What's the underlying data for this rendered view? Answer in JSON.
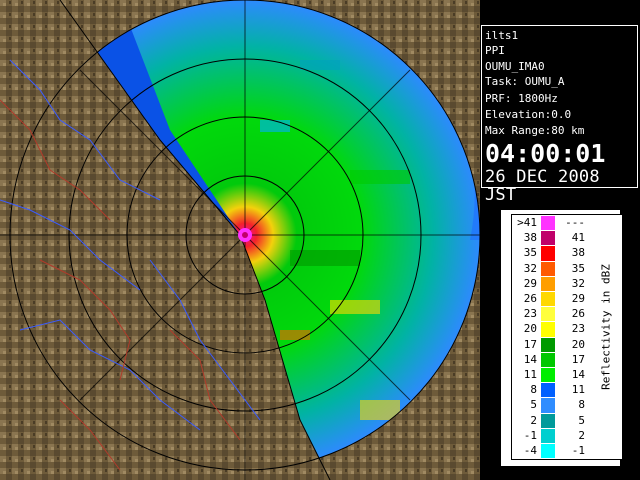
{
  "info": {
    "station": "ilts1",
    "mode": "PPI",
    "product": "OUMU_IMA0",
    "task": "Task: OUMU_A",
    "prf": "PRF: 1800Hz",
    "elevation": "Elevation:0.0",
    "max_range": "Max Range:80 km",
    "time": "04:00:01",
    "date": "26 DEC 2008 JST"
  },
  "legend": {
    "title": "Reflectivity in dBZ",
    "rows": [
      {
        "low": ">41",
        "high": "---",
        "color": "#ff33ff"
      },
      {
        "low": "38",
        "high": "41",
        "color": "#c0006a"
      },
      {
        "low": "35",
        "high": "38",
        "color": "#ff0000"
      },
      {
        "low": "32",
        "high": "35",
        "color": "#ff5a00"
      },
      {
        "low": "29",
        "high": "32",
        "color": "#ff9e00"
      },
      {
        "low": "26",
        "high": "29",
        "color": "#ffd800"
      },
      {
        "low": "23",
        "high": "26",
        "color": "#ffff3c"
      },
      {
        "low": "20",
        "high": "23",
        "color": "#ffff00"
      },
      {
        "low": "17",
        "high": "20",
        "color": "#009a00"
      },
      {
        "low": "14",
        "high": "17",
        "color": "#00c800"
      },
      {
        "low": "11",
        "high": "14",
        "color": "#00ee00"
      },
      {
        "low": "8",
        "high": "11",
        "color": "#0060ff"
      },
      {
        "low": "5",
        "high": "8",
        "color": "#2f8dff"
      },
      {
        "low": "2",
        "high": "5",
        "color": "#009a9a"
      },
      {
        "low": "-1",
        "high": "2",
        "color": "#00cfcf"
      },
      {
        "low": "-4",
        "high": "-1",
        "color": "#00ffff"
      }
    ]
  },
  "colors": {
    "terrain": "#7a6540",
    "sea_echo": "#0a52e6",
    "range_ring": "#000000",
    "river": "#3b5cff",
    "boundary": "#b13a2a"
  }
}
